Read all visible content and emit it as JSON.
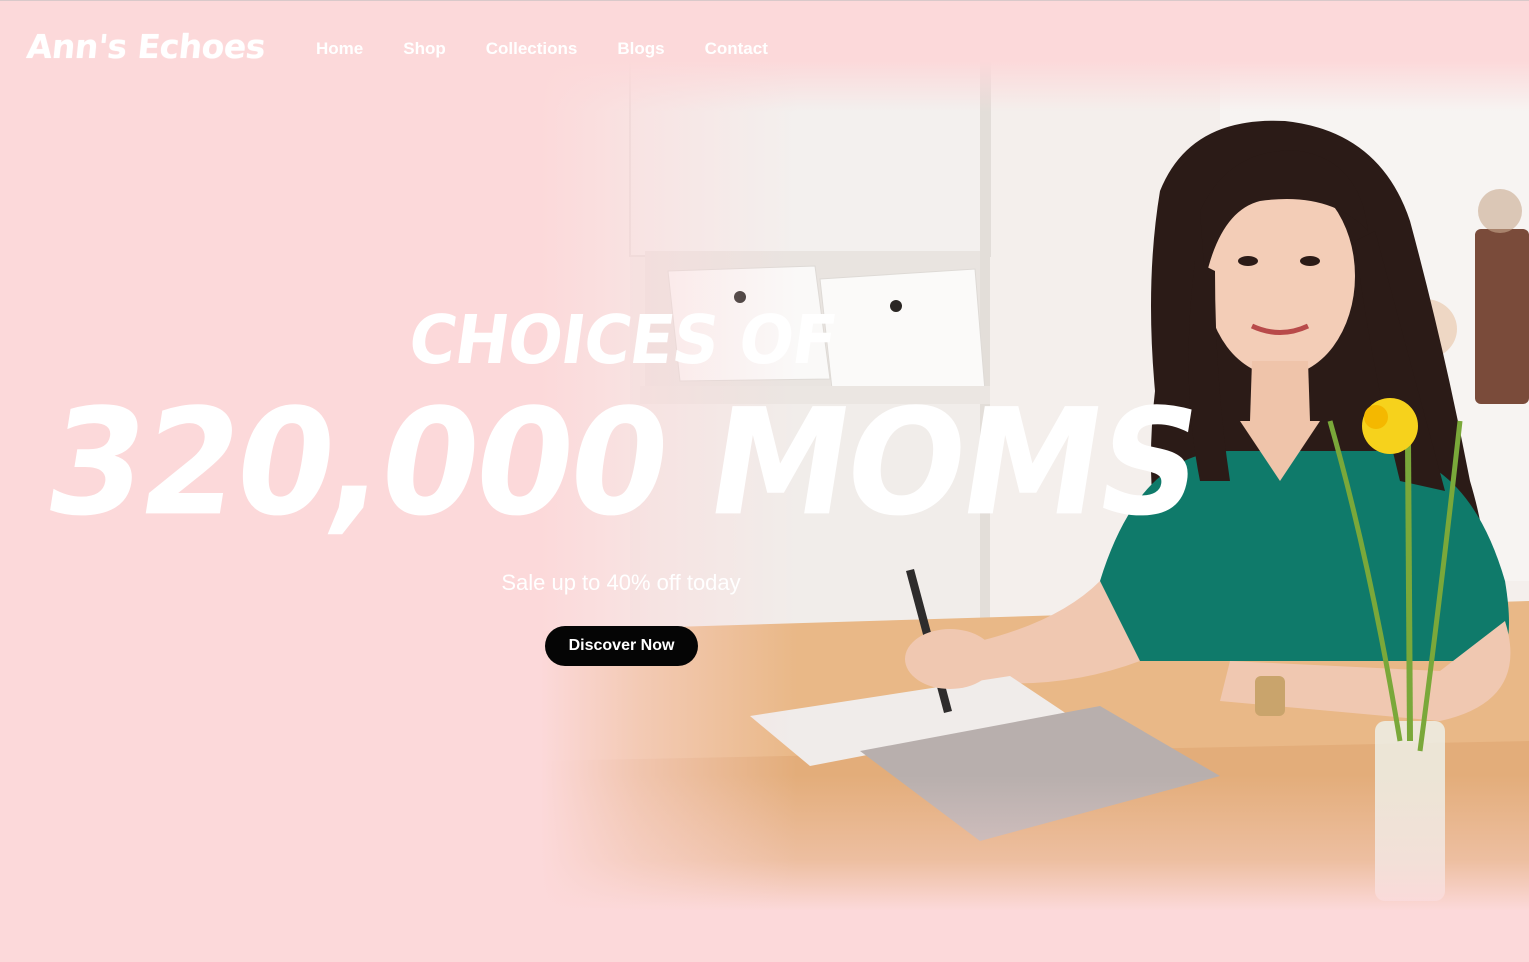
{
  "brand": {
    "logo_text": "Ann's Echoes"
  },
  "nav": {
    "items": [
      {
        "label": "Home"
      },
      {
        "label": "Shop"
      },
      {
        "label": "Collections"
      },
      {
        "label": "Blogs"
      },
      {
        "label": "Contact"
      }
    ]
  },
  "hero": {
    "kicker": "CHOICES OF",
    "title": "320,000 MOMS",
    "subtitle": "Sale up to 40% off today",
    "cta_label": "Discover Now"
  },
  "colors": {
    "background": "#fcd9da",
    "text": "#ffffff",
    "cta_background": "#050505",
    "cta_text": "#ffffff"
  }
}
